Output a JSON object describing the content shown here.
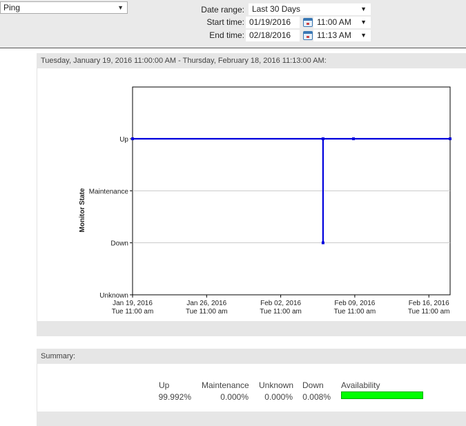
{
  "toolbar": {
    "monitor_select_value": "Ping",
    "date_range_label": "Date range:",
    "date_range_value": "Last 30 Days",
    "start_time_label": "Start time:",
    "start_date": "01/19/2016",
    "start_time": "11:00 AM",
    "end_time_label": "End time:",
    "end_date": "02/18/2016",
    "end_time": "11:13 AM"
  },
  "chart_panel": {
    "header": "Tuesday, January 19, 2016 11:00:00 AM - Thursday, February 18, 2016 11:13:00 AM:"
  },
  "chart_data": {
    "type": "line",
    "title": "",
    "xlabel": "",
    "ylabel": "Monitor State",
    "y_categories": [
      "Unknown",
      "Down",
      "Maintenance",
      "Up"
    ],
    "x_ticks": [
      {
        "date": "Jan 19, 2016",
        "sub": "Tue 11:00 am"
      },
      {
        "date": "Jan 26, 2016",
        "sub": "Tue 11:00 am"
      },
      {
        "date": "Feb 02, 2016",
        "sub": "Tue 11:00 am"
      },
      {
        "date": "Feb 09, 2016",
        "sub": "Tue 11:00 am"
      },
      {
        "date": "Feb 16, 2016",
        "sub": "Tue 11:00 am"
      }
    ],
    "xlim": [
      "2016-01-19 11:00",
      "2016-02-18 11:13"
    ],
    "series": [
      {
        "points": [
          {
            "x": "2016-01-19 11:00",
            "y": "Up"
          },
          {
            "x": "2016-02-06 11:00",
            "y": "Up"
          },
          {
            "x": "2016-02-06 11:00",
            "y": "Down"
          },
          {
            "x": "2016-02-06 11:00",
            "y": "Up"
          },
          {
            "x": "2016-02-09 08:00",
            "y": "Up"
          },
          {
            "x": "2016-02-18 11:13",
            "y": "Up"
          }
        ]
      }
    ],
    "grid": true,
    "line_color": "#0000dd"
  },
  "summary": {
    "header": "Summary:",
    "columns": [
      {
        "label": "Up",
        "value": "99.992%"
      },
      {
        "label": "Maintenance",
        "value": "0.000%"
      },
      {
        "label": "Unknown",
        "value": "0.000%"
      },
      {
        "label": "Down",
        "value": "0.008%"
      }
    ],
    "availability_label": "Availability",
    "availability_fraction": 0.99992,
    "availability_color": "#00ff00"
  }
}
